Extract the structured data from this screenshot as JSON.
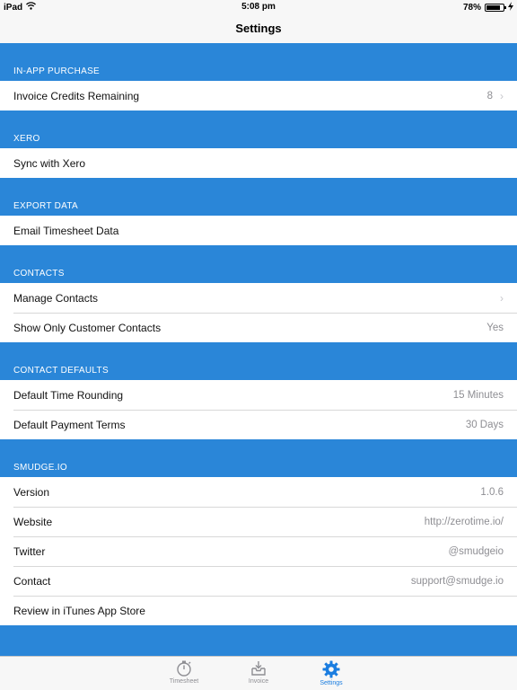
{
  "status": {
    "device": "iPad",
    "time": "5:08 pm",
    "battery": "78%"
  },
  "nav": {
    "title": "Settings"
  },
  "sections": [
    {
      "header": "IN-APP PURCHASE",
      "rows": [
        {
          "label": "Invoice Credits Remaining",
          "value": "8",
          "chevron": true
        }
      ]
    },
    {
      "header": "XERO",
      "rows": [
        {
          "label": "Sync with Xero",
          "value": "",
          "chevron": false
        }
      ]
    },
    {
      "header": "EXPORT DATA",
      "rows": [
        {
          "label": "Email Timesheet Data",
          "value": "",
          "chevron": false
        }
      ]
    },
    {
      "header": "CONTACTS",
      "rows": [
        {
          "label": "Manage Contacts",
          "value": "",
          "chevron": true
        },
        {
          "label": "Show Only Customer Contacts",
          "value": "Yes",
          "chevron": false
        }
      ]
    },
    {
      "header": "CONTACT DEFAULTS",
      "rows": [
        {
          "label": "Default Time Rounding",
          "value": "15 Minutes",
          "chevron": false
        },
        {
          "label": "Default Payment Terms",
          "value": "30 Days",
          "chevron": false
        }
      ]
    },
    {
      "header": "SMUDGE.IO",
      "rows": [
        {
          "label": "Version",
          "value": "1.0.6",
          "chevron": false
        },
        {
          "label": "Website",
          "value": "http://zerotime.io/",
          "chevron": false
        },
        {
          "label": "Twitter",
          "value": "@smudgeio",
          "chevron": false
        },
        {
          "label": "Contact",
          "value": "support@smudge.io",
          "chevron": false
        },
        {
          "label": "Review in iTunes App Store",
          "value": "",
          "chevron": false
        }
      ]
    }
  ],
  "tabs": [
    {
      "label": "Timesheet",
      "icon": "stopwatch-icon",
      "active": false
    },
    {
      "label": "Invoice",
      "icon": "inbox-download-icon",
      "active": false
    },
    {
      "label": "Settings",
      "icon": "gear-icon",
      "active": true
    }
  ],
  "colors": {
    "background": "#2a86d8",
    "active_tab": "#1a7de0",
    "inactive_tab": "#8e8e93"
  }
}
